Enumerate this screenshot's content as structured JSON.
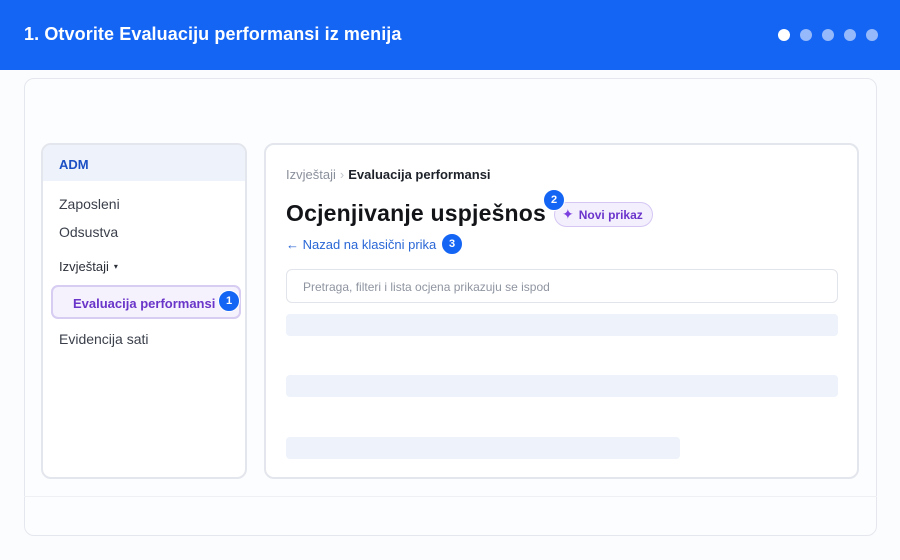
{
  "header": {
    "title": "1. Otvorite Evaluaciju performansi iz menija",
    "steps_total": 5,
    "current_step": 1
  },
  "sidebar": {
    "brand": "ADM",
    "items": [
      {
        "label": "Zaposleni"
      },
      {
        "label": "Odsustva"
      }
    ],
    "group": {
      "label": "Izvještaji",
      "caret": "▾"
    },
    "active_item": {
      "label": "Evaluacija performansi"
    },
    "bottom_item": {
      "label": "Evidencija sati"
    }
  },
  "main": {
    "breadcrumb": {
      "parent": "Izvještaji",
      "separator": "›",
      "current": "Evaluacija performansi"
    },
    "title": "Ocjenjivanje uspješnos",
    "new_view": {
      "icon": "sparkle-icon",
      "label": "Novi prikaz"
    },
    "back_link": "← Nazad na klasični prika",
    "search_placeholder": "Pretraga, filteri i lista ocjena prikazuju se ispod"
  },
  "markers": [
    "1",
    "2",
    "3"
  ],
  "colors": {
    "primary": "#1565f5",
    "accent_purple": "#6a35c9",
    "link": "#2a67d6"
  }
}
